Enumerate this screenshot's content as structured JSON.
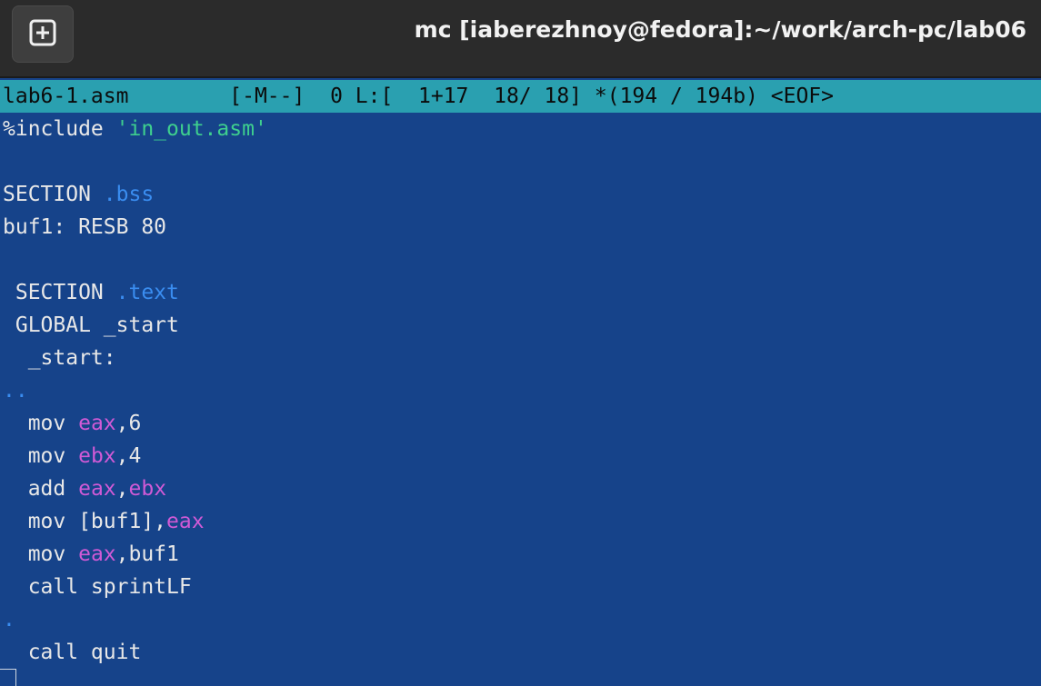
{
  "window": {
    "title": "mc [iaberezhnoy@fedora]:~/work/arch-pc/lab06",
    "new_tab_icon": "plus-square-icon"
  },
  "status": {
    "filename": "lab6-1.asm",
    "mode": "[-M--]",
    "column": "0",
    "line_info": "L:[  1+17  18/ 18]",
    "size_info": "*(194 / 194b)",
    "eof": "<EOF>"
  },
  "code_lines": [
    [
      {
        "t": "%include ",
        "c": "plain"
      },
      {
        "t": "'in_out.asm'",
        "c": "str"
      }
    ],
    [],
    [
      {
        "t": "SECTION ",
        "c": "plain"
      },
      {
        "t": ".bss",
        "c": "dir"
      }
    ],
    [
      {
        "t": "buf1: RESB 80",
        "c": "plain"
      }
    ],
    [],
    [
      {
        "t": " SECTION ",
        "c": "plain"
      },
      {
        "t": ".text",
        "c": "dir"
      }
    ],
    [
      {
        "t": " GLOBAL _start",
        "c": "plain"
      }
    ],
    [
      {
        "t": "  _start:",
        "c": "plain"
      }
    ],
    [
      {
        "t": "..",
        "c": "dots"
      }
    ],
    [
      {
        "t": "  mov ",
        "c": "plain"
      },
      {
        "t": "eax",
        "c": "reg"
      },
      {
        "t": ",6",
        "c": "plain"
      }
    ],
    [
      {
        "t": "  mov ",
        "c": "plain"
      },
      {
        "t": "ebx",
        "c": "reg"
      },
      {
        "t": ",4",
        "c": "plain"
      }
    ],
    [
      {
        "t": "  add ",
        "c": "plain"
      },
      {
        "t": "eax",
        "c": "reg"
      },
      {
        "t": ",",
        "c": "plain"
      },
      {
        "t": "ebx",
        "c": "reg"
      }
    ],
    [
      {
        "t": "  mov [buf1],",
        "c": "plain"
      },
      {
        "t": "eax",
        "c": "reg"
      }
    ],
    [
      {
        "t": "  mov ",
        "c": "plain"
      },
      {
        "t": "eax",
        "c": "reg"
      },
      {
        "t": ",buf1",
        "c": "plain"
      }
    ],
    [
      {
        "t": "  call sprintLF",
        "c": "plain"
      }
    ],
    [
      {
        "t": ".",
        "c": "dots"
      }
    ],
    [
      {
        "t": "  call quit",
        "c": "plain"
      }
    ]
  ],
  "colors": {
    "editor_bg": "#16438a",
    "status_bg": "#2aa0b0",
    "string": "#3ecf8e",
    "directive": "#3a8df0",
    "register": "#d05ad6"
  }
}
